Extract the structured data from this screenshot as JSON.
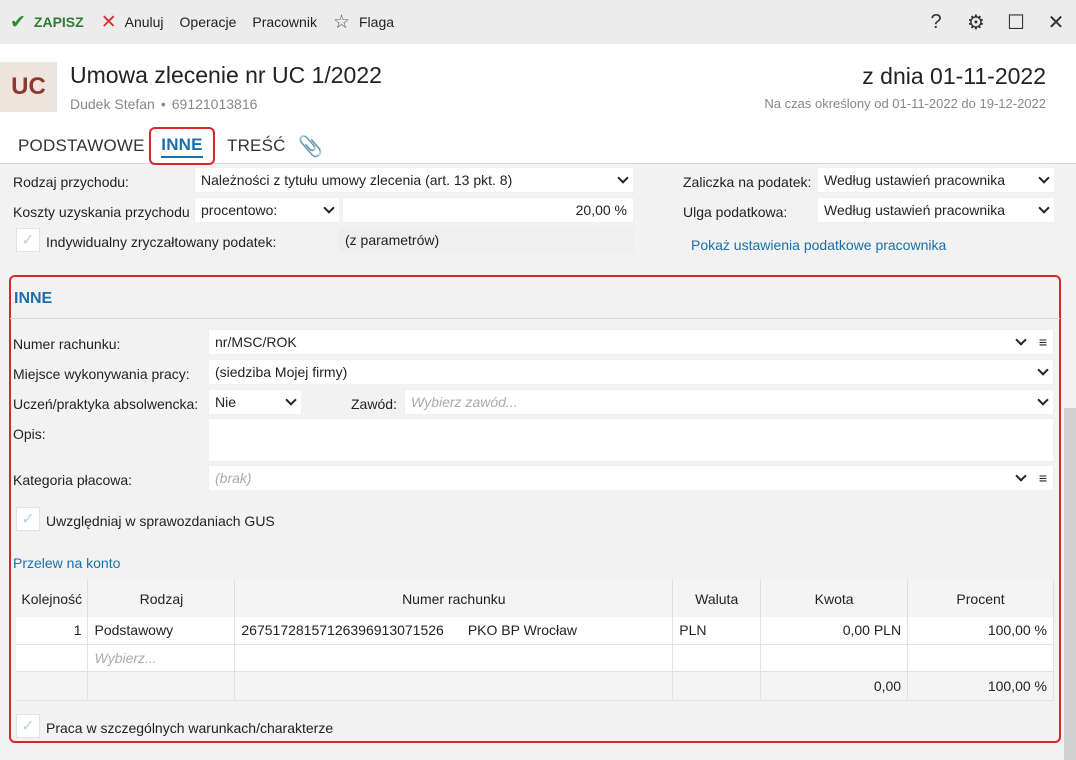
{
  "toolbar": {
    "save": "ZAPISZ",
    "cancel": "Anuluj",
    "operations": "Operacje",
    "employee": "Pracownik",
    "flag": "Flaga"
  },
  "header": {
    "badge": "UC",
    "title": "Umowa zlecenie nr UC 1/2022",
    "employee_name": "Dudek Stefan",
    "employee_id": "69121013816",
    "date": "z dnia 01-11-2022",
    "period": "Na czas określony od 01-11-2022 do 19-12-2022"
  },
  "tabs": {
    "basic": "PODSTAWOWE",
    "other": "INNE",
    "content": "TREŚĆ"
  },
  "tax": {
    "income_type_label": "Rodzaj przychodu:",
    "income_type_value": "Należności z tytułu umowy zlecenia (art. 13 pkt. 8)",
    "costs_label": "Koszty uzyskania przychodu",
    "costs_mode": "procentowo:",
    "costs_value": "20,00 %",
    "flat_tax_label": "Indywidualny zryczałtowany podatek:",
    "flat_tax_value": "(z parametrów)",
    "advance_label": "Zaliczka na podatek:",
    "advance_value": "Według ustawień pracownika",
    "relief_label": "Ulga podatkowa:",
    "relief_value": "Według ustawień pracownika",
    "show_settings_link": "Pokaż ustawienia podatkowe pracownika"
  },
  "other": {
    "section_title": "INNE",
    "account_number_label": "Numer rachunku:",
    "account_number_value": "nr/MSC/ROK",
    "workplace_label": "Miejsce wykonywania pracy:",
    "workplace_value": "(siedziba Mojej firmy)",
    "apprentice_label": "Uczeń/praktyka absolwencka:",
    "apprentice_value": "Nie",
    "profession_label": "Zawód:",
    "profession_placeholder": "Wybierz zawód...",
    "description_label": "Opis:",
    "description_value": "",
    "pay_category_label": "Kategoria płacowa:",
    "pay_category_placeholder": "(brak)",
    "gus_label": "Uwzględniaj w sprawozdaniach GUS",
    "transfer_link": "Przelew na konto",
    "special_conditions_label": "Praca w szczególnych warunkach/charakterze"
  },
  "table": {
    "headers": [
      "Kolejność",
      "Rodzaj",
      "Numer rachunku",
      "Waluta",
      "Kwota",
      "Procent"
    ],
    "rows": [
      {
        "order": "1",
        "type": "Podstawowy",
        "account": "26751728157126396913071526",
        "bank": "PKO BP Wrocław",
        "currency": "PLN",
        "amount": "0,00 PLN",
        "percent": "100,00 %"
      }
    ],
    "new_row_placeholder": "Wybierz...",
    "sum_amount": "0,00",
    "sum_percent": "100,00 %"
  }
}
